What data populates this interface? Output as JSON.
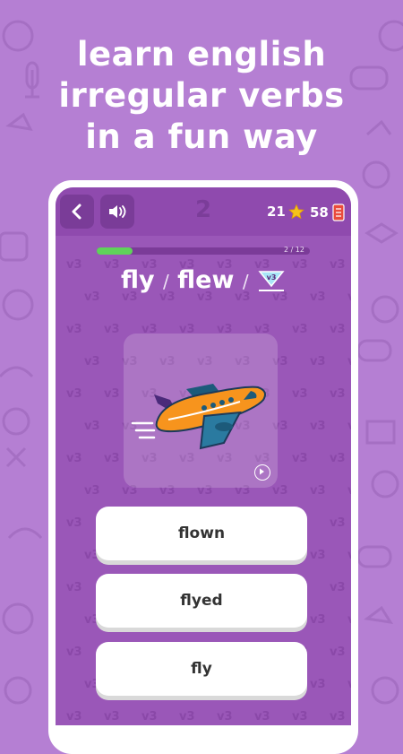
{
  "promo": {
    "headline_lines": [
      "learn english",
      "irregular verbs",
      "in a fun way"
    ]
  },
  "header": {
    "back_icon": "chevron-left-icon",
    "sound_icon": "speaker-icon",
    "level_number": "2",
    "stars": "21",
    "coins": "58"
  },
  "progress": {
    "current": 2,
    "total": 12,
    "label": "2 / 12"
  },
  "question": {
    "form1": "fly",
    "form2": "flew",
    "separator": "/",
    "badge": "v3"
  },
  "picture": {
    "subject": "airplane",
    "play_icon": "play-icon"
  },
  "answers": [
    {
      "label": "flown"
    },
    {
      "label": "flyed"
    },
    {
      "label": "fly"
    }
  ],
  "pattern_text": "v3",
  "colors": {
    "background": "#b57fd3",
    "screen": "#9a57b8",
    "topbar": "#8f4aae",
    "progress": "#5fd35a",
    "star": "#f4c21c"
  }
}
